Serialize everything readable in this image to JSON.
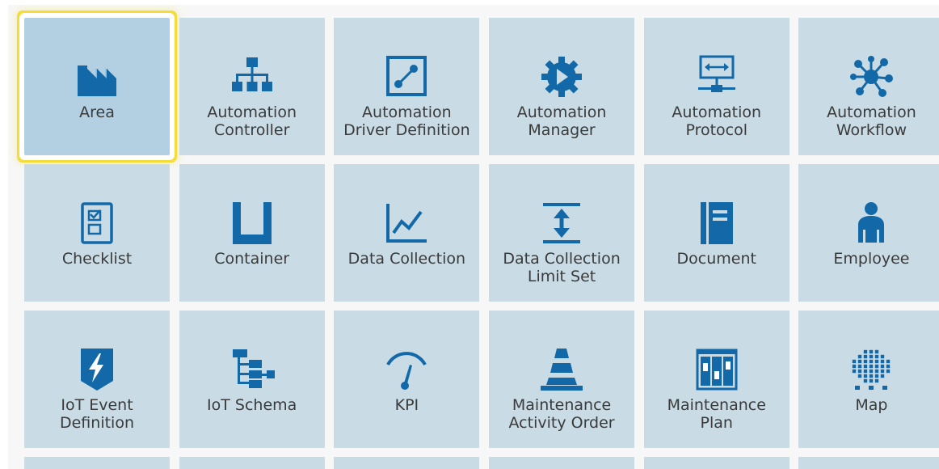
{
  "colors": {
    "tile": "#c9dce6",
    "tile_selected": "#b2d0e1",
    "icon": "#1369a8",
    "highlight": "#f4dc3a"
  },
  "tiles": [
    {
      "name": "tile-area",
      "icon": "factory-icon",
      "lines": [
        "Area"
      ],
      "selected": true
    },
    {
      "name": "tile-automation-controller",
      "icon": "hierarchy-icon",
      "lines": [
        "Automation",
        "Controller"
      ]
    },
    {
      "name": "tile-automation-driver-definition",
      "icon": "driver-icon",
      "lines": [
        "Automation",
        "Driver Definition"
      ]
    },
    {
      "name": "tile-automation-manager",
      "icon": "gear-play-icon",
      "lines": [
        "Automation",
        "Manager"
      ]
    },
    {
      "name": "tile-automation-protocol",
      "icon": "protocol-icon",
      "lines": [
        "Automation",
        "Protocol"
      ]
    },
    {
      "name": "tile-automation-workflow",
      "icon": "network-icon",
      "lines": [
        "Automation",
        "Workflow"
      ]
    },
    {
      "name": "tile-checklist",
      "icon": "checklist-icon",
      "lines": [
        "Checklist"
      ]
    },
    {
      "name": "tile-container",
      "icon": "container-icon",
      "lines": [
        "Container"
      ]
    },
    {
      "name": "tile-data-collection",
      "icon": "line-chart-icon",
      "lines": [
        "Data Collection"
      ]
    },
    {
      "name": "tile-data-collection-limit-set",
      "icon": "limit-icon",
      "lines": [
        "Data Collection",
        "Limit Set"
      ]
    },
    {
      "name": "tile-document",
      "icon": "document-icon",
      "lines": [
        "Document"
      ]
    },
    {
      "name": "tile-employee",
      "icon": "person-icon",
      "lines": [
        "Employee"
      ]
    },
    {
      "name": "tile-iot-event-definition",
      "icon": "lightning-tag-icon",
      "lines": [
        "IoT Event",
        "Definition"
      ]
    },
    {
      "name": "tile-iot-schema",
      "icon": "schema-tree-icon",
      "lines": [
        "IoT Schema"
      ]
    },
    {
      "name": "tile-kpi",
      "icon": "gauge-icon",
      "lines": [
        "KPI"
      ]
    },
    {
      "name": "tile-maintenance-activity-order",
      "icon": "cone-icon",
      "lines": [
        "Maintenance",
        "Activity Order"
      ]
    },
    {
      "name": "tile-maintenance-plan",
      "icon": "plan-board-icon",
      "lines": [
        "Maintenance",
        "Plan"
      ]
    },
    {
      "name": "tile-map",
      "icon": "map-grid-icon",
      "lines": [
        "Map"
      ]
    }
  ]
}
